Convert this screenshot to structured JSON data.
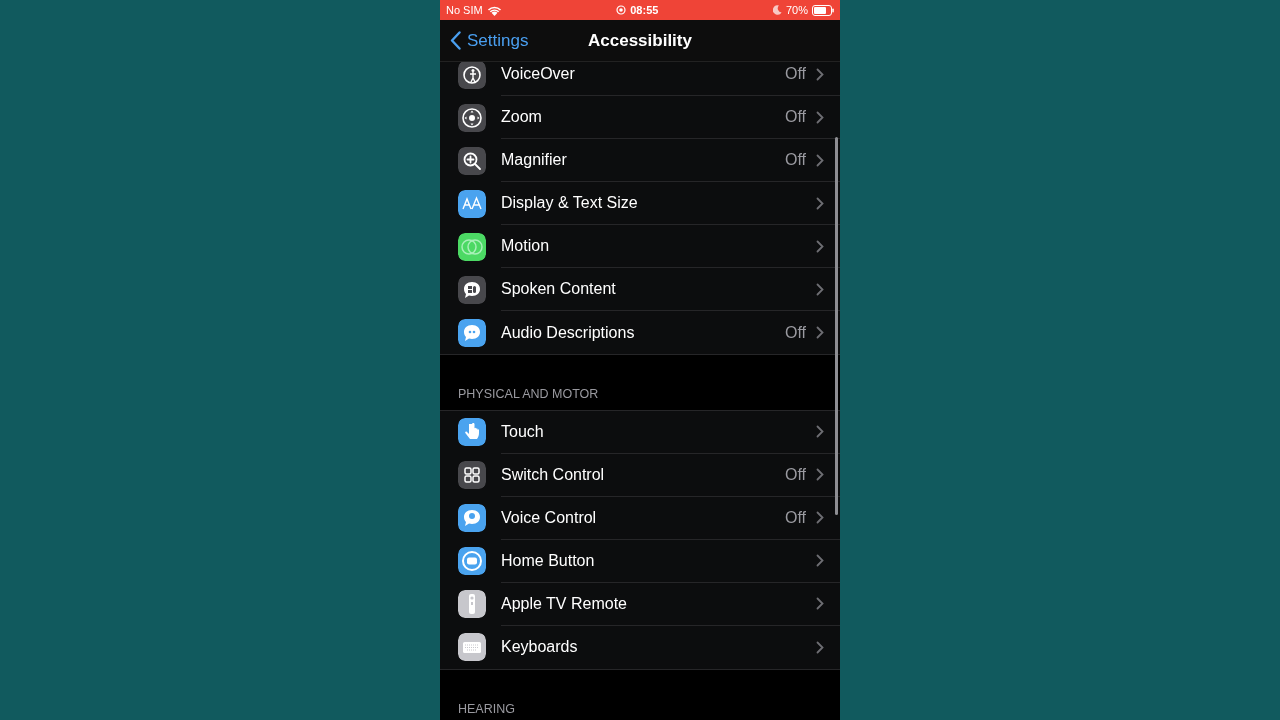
{
  "status_bar": {
    "carrier": "No SIM",
    "time": "08:55",
    "battery": "70%"
  },
  "nav": {
    "back": "Settings",
    "title": "Accessibility"
  },
  "sections": [
    {
      "items": [
        {
          "label": "VoiceOver",
          "value": "Off",
          "color": "#48484c"
        },
        {
          "label": "Zoom",
          "value": "Off",
          "color": "#48484c"
        },
        {
          "label": "Magnifier",
          "value": "Off",
          "color": "#48484c"
        },
        {
          "label": "Display & Text Size",
          "color": "#4aa3ef"
        },
        {
          "label": "Motion",
          "color": "#4cd964"
        },
        {
          "label": "Spoken Content",
          "color": "#48484c"
        },
        {
          "label": "Audio Descriptions",
          "value": "Off",
          "color": "#4aa3ef"
        }
      ]
    },
    {
      "header": "PHYSICAL AND MOTOR",
      "items": [
        {
          "label": "Touch",
          "color": "#4aa3ef"
        },
        {
          "label": "Switch Control",
          "value": "Off",
          "color": "#48484c"
        },
        {
          "label": "Voice Control",
          "value": "Off",
          "color": "#4aa3ef"
        },
        {
          "label": "Home Button",
          "color": "#4aa3ef"
        },
        {
          "label": "Apple TV Remote",
          "color": "#c7c7cc"
        },
        {
          "label": "Keyboards",
          "color": "#c7c7cc"
        }
      ]
    },
    {
      "header": "HEARING"
    }
  ]
}
